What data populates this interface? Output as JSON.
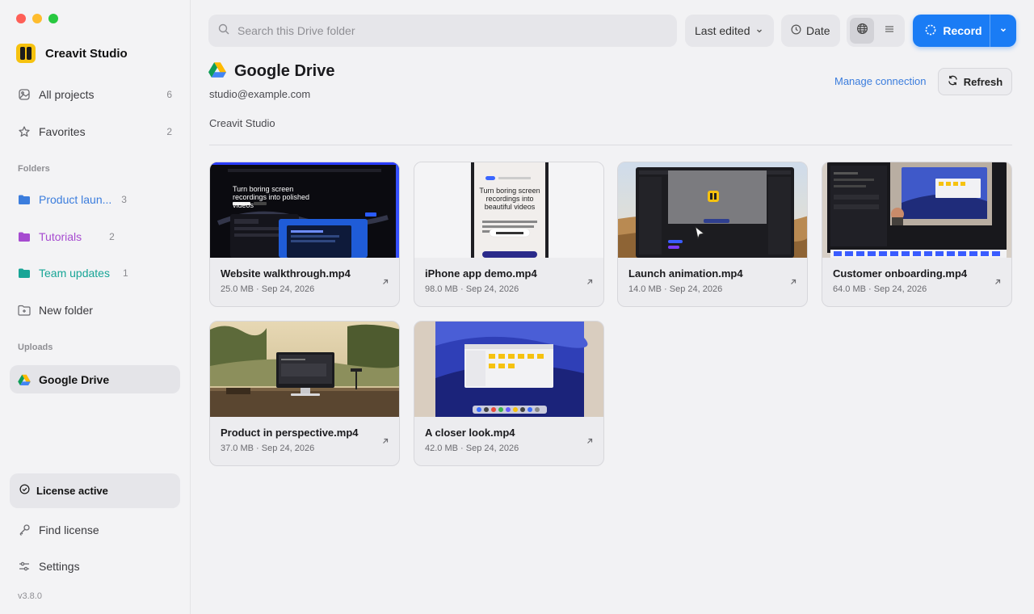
{
  "app": {
    "name": "Creavit Studio",
    "version": "v3.8.0"
  },
  "sidebar": {
    "items": [
      {
        "label": "All projects",
        "count": "6",
        "icon": "image-stack-icon"
      },
      {
        "label": "Favorites",
        "count": "2",
        "icon": "star-icon"
      }
    ],
    "folders_title": "Folders",
    "folders": [
      {
        "label": "Product laun...",
        "count": "3",
        "color": "#3b7ddd"
      },
      {
        "label": "Tutorials",
        "count": "2",
        "color": "#a64bd0"
      },
      {
        "label": "Team updates",
        "count": "1",
        "color": "#17a596"
      }
    ],
    "new_folder": "New folder",
    "uploads_title": "Uploads",
    "uploads": [
      {
        "label": "Google Drive",
        "active": true
      }
    ],
    "license": "License active",
    "find_license": "Find license",
    "settings": "Settings"
  },
  "toolbar": {
    "search_placeholder": "Search this Drive folder",
    "sort_label": "Last edited",
    "date_label": "Date",
    "record_label": "Record",
    "accent": "#1a7cf5"
  },
  "header": {
    "title": "Google Drive",
    "email": "studio@example.com",
    "breadcrumb": "Creavit Studio",
    "manage": "Manage connection",
    "refresh": "Refresh"
  },
  "files": [
    {
      "name": "Website walkthrough.mp4",
      "meta": "25.0 MB · Sep 24, 2026",
      "thumb_text": "Turn boring screen recordings into polished videos"
    },
    {
      "name": "iPhone app demo.mp4",
      "meta": "98.0 MB · Sep 24, 2026",
      "thumb_text": "Turn boring screen recordings into beautiful videos"
    },
    {
      "name": "Launch animation.mp4",
      "meta": "14.0 MB · Sep 24, 2026"
    },
    {
      "name": "Customer onboarding.mp4",
      "meta": "64.0 MB · Sep 24, 2026"
    },
    {
      "name": "Product in perspective.mp4",
      "meta": "37.0 MB · Sep 24, 2026"
    },
    {
      "name": "A closer look.mp4",
      "meta": "42.0 MB · Sep 24, 2026"
    }
  ]
}
